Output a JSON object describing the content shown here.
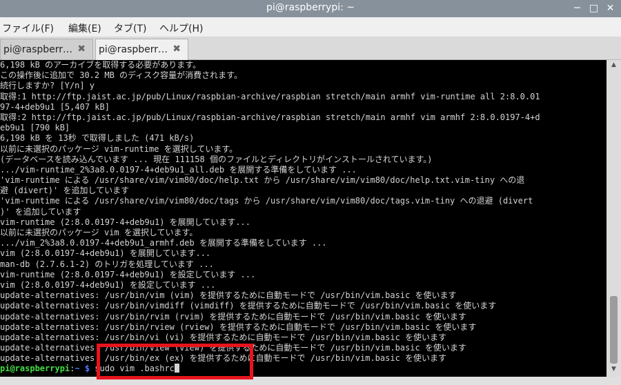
{
  "window": {
    "title": "pi@raspberrypi: ~",
    "minimize_icon": "─",
    "maximize_icon": "□",
    "close_icon": "✕"
  },
  "menu": [
    {
      "label": "ファイル(F)"
    },
    {
      "label": "編集(E)"
    },
    {
      "label": "タブ(T)"
    },
    {
      "label": "ヘルプ(H)"
    }
  ],
  "tabs": [
    {
      "label": "pi@raspberr…",
      "close": "✖",
      "active": false
    },
    {
      "label": "pi@raspberr…",
      "close": "✖",
      "active": true
    }
  ],
  "terminal": {
    "lines": [
      "6,198 kB のアーカイブを取得する必要があります。",
      "この操作後に追加で 30.2 MB のディスク容量が消費されます。",
      "続行しますか? [Y/n] y",
      "取得:1 http://ftp.jaist.ac.jp/pub/Linux/raspbian-archive/raspbian stretch/main armhf vim-runtime all 2:8.0.01",
      "97-4+deb9u1 [5,407 kB]",
      "取得:2 http://ftp.jaist.ac.jp/pub/Linux/raspbian-archive/raspbian stretch/main armhf vim armhf 2:8.0.0197-4+d",
      "eb9u1 [790 kB]",
      "6,198 kB を 13秒 で取得しました (471 kB/s)",
      "以前に未選択のパッケージ vim-runtime を選択しています。",
      "(データベースを読み込んでいます ... 現在 111158 個のファイルとディレクトリがインストールされています。)",
      ".../vim-runtime_2%3a8.0.0197-4+deb9u1_all.deb を展開する準備をしています ...",
      "'vim-runtime による /usr/share/vim/vim80/doc/help.txt から /usr/share/vim/vim80/doc/help.txt.vim-tiny への退",
      "避 (divert)' を追加しています",
      "'vim-runtime による /usr/share/vim/vim80/doc/tags から /usr/share/vim/vim80/doc/tags.vim-tiny への退避 (divert",
      ")' を追加しています",
      "vim-runtime (2:8.0.0197-4+deb9u1) を展開しています...",
      "以前に未選択のパッケージ vim を選択しています。",
      ".../vim_2%3a8.0.0197-4+deb9u1_armhf.deb を展開する準備をしています ...",
      "vim (2:8.0.0197-4+deb9u1) を展開しています...",
      "man-db (2.7.6.1-2) のトリガを処理しています ...",
      "vim-runtime (2:8.0.0197-4+deb9u1) を設定しています ...",
      "vim (2:8.0.0197-4+deb9u1) を設定しています ...",
      "update-alternatives: /usr/bin/vim (vim) を提供するために自動モードで /usr/bin/vim.basic を使います",
      "update-alternatives: /usr/bin/vimdiff (vimdiff) を提供するために自動モードで /usr/bin/vim.basic を使います",
      "update-alternatives: /usr/bin/rvim (rvim) を提供するために自動モードで /usr/bin/vim.basic を使います",
      "update-alternatives: /usr/bin/rview (rview) を提供するために自動モードで /usr/bin/vim.basic を使います",
      "update-alternatives: /usr/bin/vi (vi) を提供するために自動モードで /usr/bin/vim.basic を使います",
      "update-alternatives: /usr/bin/view (view) を提供するために自動モードで /usr/bin/vim.basic を使います",
      "update-alternatives: /usr/bin/ex (ex) を提供するために自動モードで /usr/bin/vim.basic を使います"
    ],
    "prompt_user": "pi@raspberrypi",
    "prompt_sep": ":",
    "prompt_path": "~ $",
    "command": " sudo vim .bashrc"
  },
  "scrollbar": {
    "up_icon": "▲",
    "down_icon": "▼"
  },
  "colors": {
    "highlight_box": "#e8141c",
    "prompt_user": "#44dd44",
    "prompt_path": "#4a7bff",
    "titlebar": "#87919b"
  }
}
